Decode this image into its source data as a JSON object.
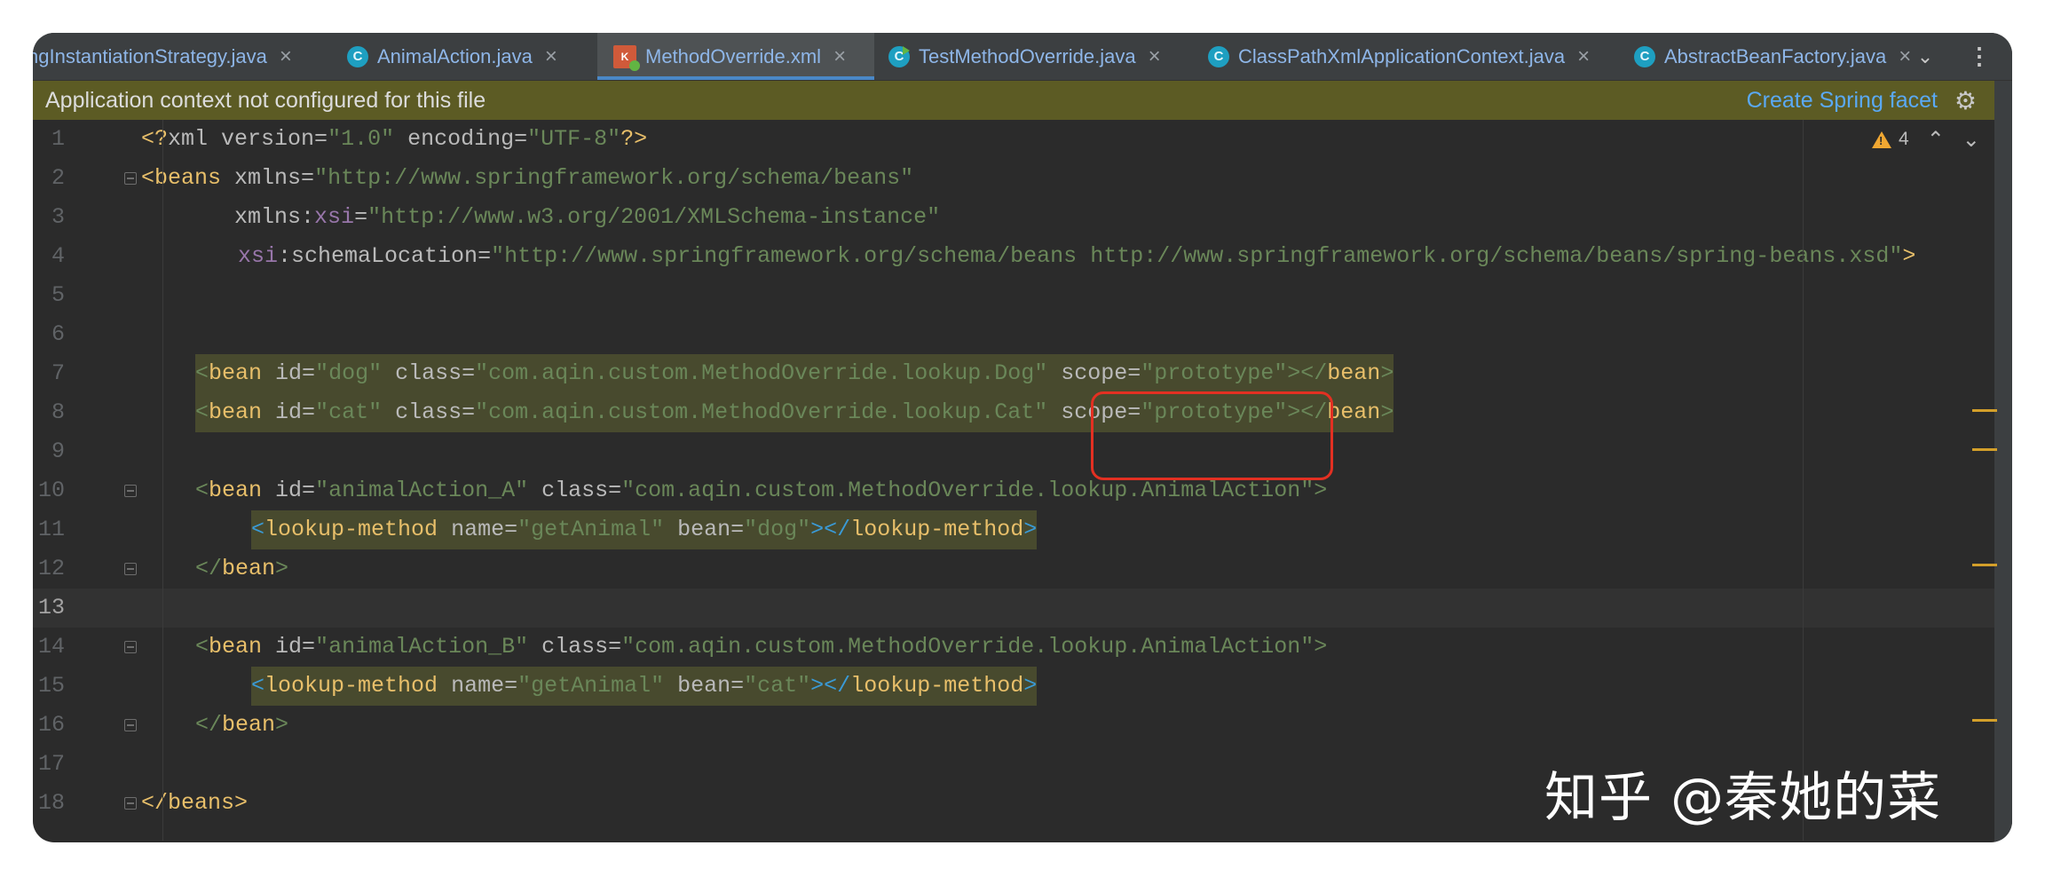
{
  "tabs": [
    {
      "label": "ngInstantiationStrategy.java",
      "icon": "java-class-icon",
      "active": false
    },
    {
      "label": "AnimalAction.java",
      "icon": "java-class-icon",
      "active": false
    },
    {
      "label": "MethodOverride.xml",
      "icon": "xml-file-icon",
      "active": true
    },
    {
      "label": "TestMethodOverride.java",
      "icon": "java-test-class-icon",
      "active": false
    },
    {
      "label": "ClassPathXmlApplicationContext.java",
      "icon": "java-class-icon",
      "active": false
    },
    {
      "label": "AbstractBeanFactory.java",
      "icon": "java-class-icon",
      "active": false
    }
  ],
  "tab_close_glyph": "×",
  "tab_icon_letter": "C",
  "tab_xml_icon_letter": "K",
  "tab_more_glyph": "⌄",
  "tab_kebab_glyph": "⋮",
  "banner": {
    "message": "Application context not configured for this file",
    "action": "Create Spring facet",
    "gear_glyph": "⚙"
  },
  "inspections": {
    "warning_count": "4",
    "up_glyph": "⌃",
    "down_glyph": "⌄"
  },
  "line_numbers": [
    "1",
    "2",
    "3",
    "4",
    "5",
    "6",
    "7",
    "8",
    "9",
    "10",
    "11",
    "12",
    "13",
    "14",
    "15",
    "16",
    "17",
    "18"
  ],
  "current_line": "13",
  "code": {
    "l1": {
      "p1": "<?",
      "p2": "xml version",
      "p3": "=",
      "p4": "\"1.0\"",
      "p5": " encoding",
      "p6": "=",
      "p7": "\"UTF-8\"",
      "p8": "?>"
    },
    "l2": {
      "p1": "<",
      "p2": "beans",
      "p3": " xmlns",
      "p4": "=",
      "p5": "\"http://www.springframework.org/schema/beans\""
    },
    "l3": {
      "p1": "       xmlns:",
      "p2": "xsi",
      "p3": "=",
      "p4": "\"http://www.w3.org/2001/XMLSchema-instance\""
    },
    "l4": {
      "p1": "xsi",
      "p2": ":schemaLocation",
      "p3": "=",
      "p4": "\"http://www.springframework.org/schema/beans http://www.springframework.org/schema/beans/spring-beans.xsd\"",
      "p5": ">"
    },
    "l7": {
      "p1": "<",
      "p2": "bean",
      "p3": " id",
      "p4": "=",
      "p5": "\"dog\"",
      "p6": " class",
      "p7": "=",
      "p8": "\"com.aqin.custom.MethodOverride.lookup.Dog\"",
      "p9": " scope",
      "p10": "=",
      "p11": "\"prototype\"",
      "p12": "></",
      "p13": "bean",
      "p14": ">"
    },
    "l8": {
      "p1": "<",
      "p2": "bean",
      "p3": " id",
      "p4": "=",
      "p5": "\"cat\"",
      "p6": " class",
      "p7": "=",
      "p8": "\"com.aqin.custom.MethodOverride.lookup.Cat\"",
      "p9": " scope",
      "p10": "=",
      "p11": "\"prototype\"",
      "p12": "></",
      "p13": "bean",
      "p14": ">"
    },
    "l10": {
      "p1": "<",
      "p2": "bean",
      "p3": " id",
      "p4": "=",
      "p5": "\"animalAction_A\"",
      "p6": " class",
      "p7": "=",
      "p8": "\"com.aqin.custom.MethodOverride.lookup.AnimalAction\"",
      "p9": ">"
    },
    "l11": {
      "p1": "<",
      "p2": "lookup-method",
      "p3": " name",
      "p4": "=",
      "p5": "\"getAnimal\"",
      "p6": " bean",
      "p7": "=",
      "p8": "\"dog\"",
      "p9": "></",
      "p10": "lookup-method",
      "p11": ">"
    },
    "l12": {
      "p1": "</",
      "p2": "bean",
      "p3": ">"
    },
    "l14": {
      "p1": "<",
      "p2": "bean",
      "p3": " id",
      "p4": "=",
      "p5": "\"animalAction_B\"",
      "p6": " class",
      "p7": "=",
      "p8": "\"com.aqin.custom.MethodOverride.lookup.AnimalAction\"",
      "p9": ">"
    },
    "l15": {
      "p1": "<",
      "p2": "lookup-method",
      "p3": " name",
      "p4": "=",
      "p5": "\"getAnimal\"",
      "p6": " bean",
      "p7": "=",
      "p8": "\"cat\"",
      "p9": "></",
      "p10": "lookup-method",
      "p11": ">"
    },
    "l16": {
      "p1": "</",
      "p2": "bean",
      "p3": ">"
    },
    "l18": {
      "p1": "</",
      "p2": "beans",
      "p3": ">"
    }
  },
  "watermark": "知乎 @秦她的菜",
  "colors": {
    "editor_bg": "#2b2b2b",
    "banner_bg": "#5c5b24",
    "link": "#5aa9f5",
    "tag": "#e8bf6a",
    "string": "#6a8759",
    "namespace": "#9876aa",
    "callout": "#e33022"
  }
}
